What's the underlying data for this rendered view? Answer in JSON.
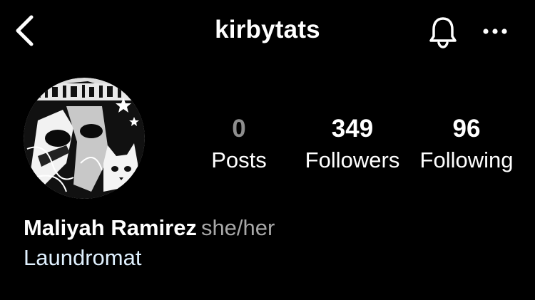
{
  "header": {
    "username": "kirbytats",
    "icons": {
      "back": "chevron-left-icon",
      "notifications": "bell-icon",
      "more": "more-horizontal-icon"
    }
  },
  "profile": {
    "stats": {
      "posts": {
        "count": "0",
        "label": "Posts"
      },
      "followers": {
        "count": "349",
        "label": "Followers"
      },
      "following": {
        "count": "96",
        "label": "Following"
      }
    },
    "full_name": "Maliyah Ramirez",
    "pronouns": "she/her",
    "bio_link": "Laundromat"
  },
  "colors": {
    "background": "#000000",
    "text": "#ffffff",
    "muted": "#a8a8a8",
    "posts_count": "#8e8e8e",
    "link": "#e0f1ff"
  }
}
